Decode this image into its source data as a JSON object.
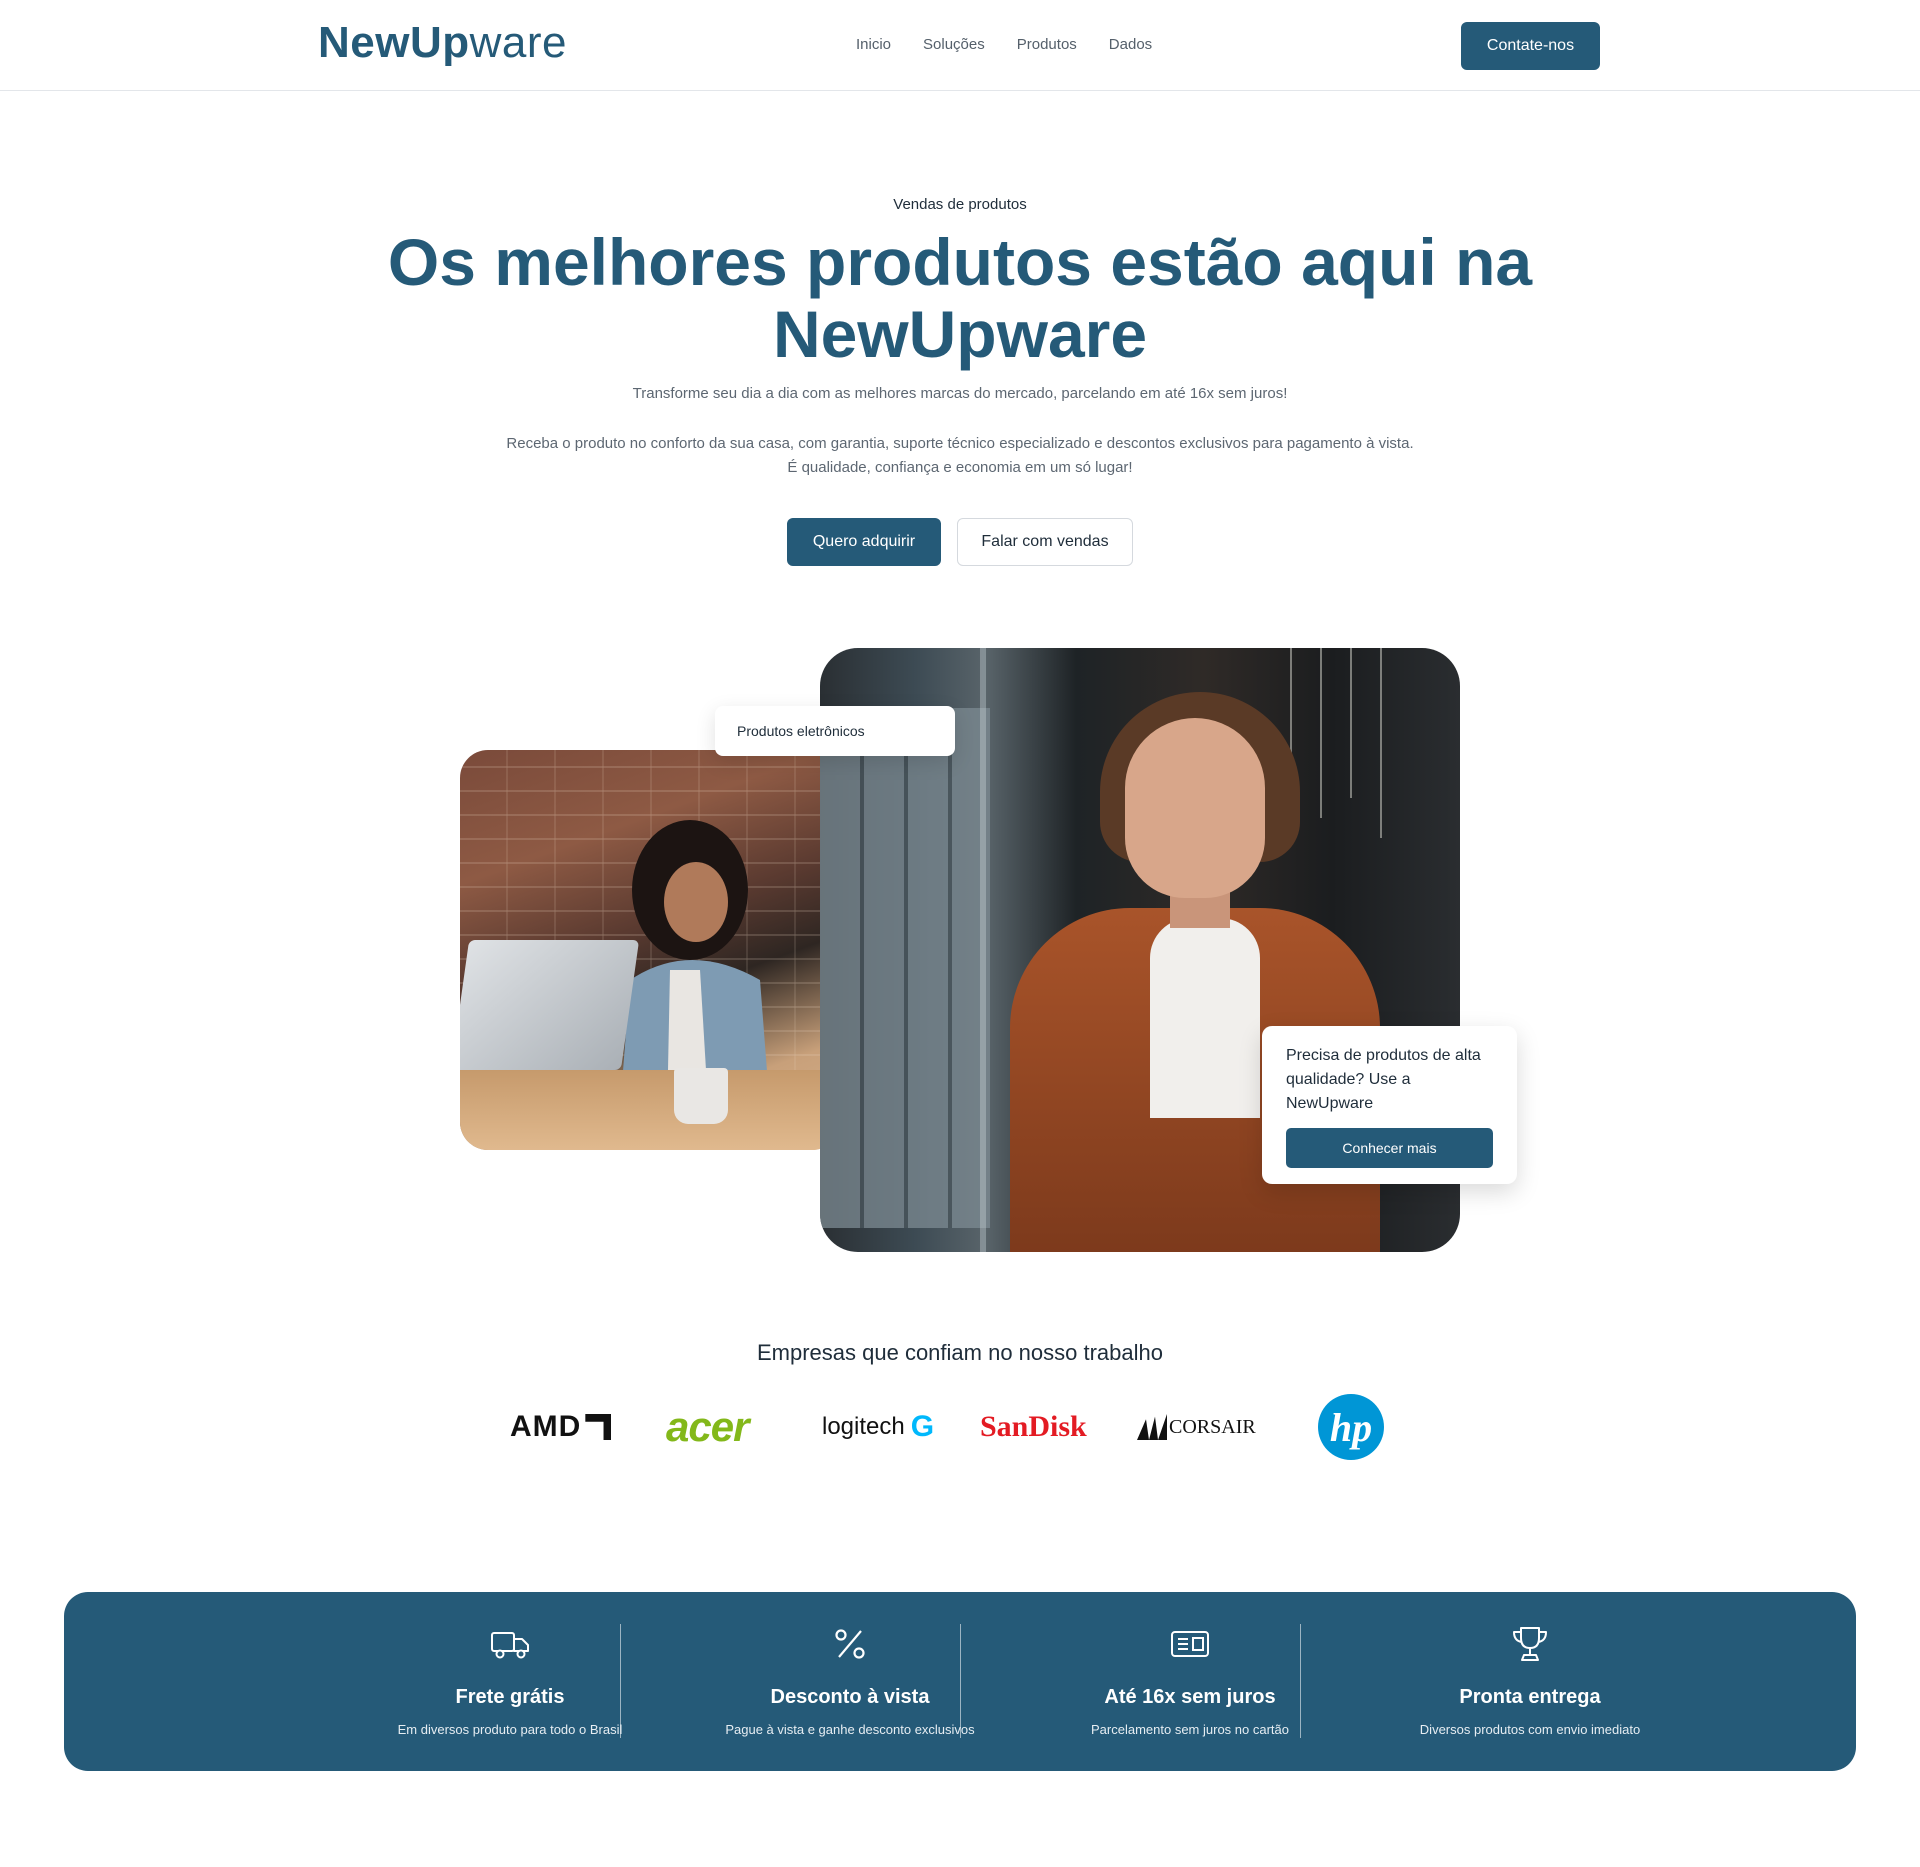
{
  "header": {
    "logo_bold": "NewUp",
    "logo_light": "ware",
    "nav": [
      "Inicio",
      "Soluções",
      "Produtos",
      "Dados"
    ],
    "contact_label": "Contate-nos"
  },
  "hero": {
    "eyebrow": "Vendas de produtos",
    "title": "Os melhores produtos estão aqui na NewUpware",
    "lead": "Transforme seu dia a dia com as melhores marcas do mercado, parcelando em até 16x sem juros!",
    "lead2_line1": "Receba o produto no conforto da sua casa, com garantia, suporte técnico especializado e descontos exclusivos para pagamento à vista.",
    "lead2_line2": "É qualidade, confiança e economia em um só lugar!",
    "cta_primary": "Quero adquirir",
    "cta_secondary": "Falar com vendas"
  },
  "gallery": {
    "tag_label": "Produtos eletrônicos",
    "card_text": "Precisa de produtos de alta qualidade? Use a NewUpware",
    "card_button": "Conhecer mais"
  },
  "partners": {
    "title": "Empresas que confiam no nosso trabalho",
    "logos": {
      "amd": "AMD",
      "acer": "acer",
      "logitech": "logitech",
      "logitech_mark": "G",
      "sandisk": "SanDisk",
      "corsair": "CORSAIR",
      "hp": "hp"
    }
  },
  "benefits": [
    {
      "icon": "truck-icon",
      "title": "Frete grátis",
      "subtitle": "Em diversos produto para todo o Brasil"
    },
    {
      "icon": "percent-icon",
      "title": "Desconto à vista",
      "subtitle": "Pague à vista e ganhe desconto exclusivos"
    },
    {
      "icon": "card-icon",
      "title": "Até 16x sem juros",
      "subtitle": "Parcelamento sem juros no cartão"
    },
    {
      "icon": "trophy-icon",
      "title": "Pronta entrega",
      "subtitle": "Diversos produtos com envio imediato"
    }
  ],
  "colors": {
    "brand": "#255a78",
    "acer": "#83b81a",
    "sandisk": "#e31b23",
    "hp": "#0096d6",
    "logitech_g": "#00b8fc"
  }
}
